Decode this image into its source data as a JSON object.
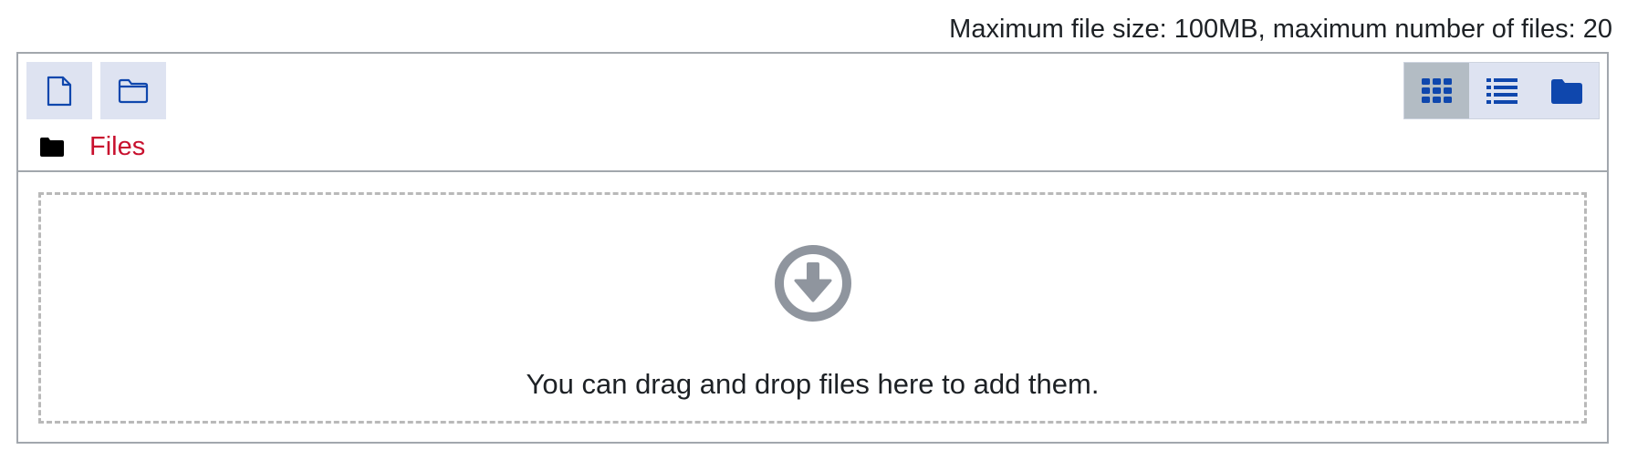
{
  "limits_text": "Maximum file size: 100MB, maximum number of files: 20",
  "toolbar": {
    "add_file_icon": "file-icon",
    "add_folder_icon": "folder-outline-icon",
    "views": [
      {
        "icon": "grid-icon",
        "active": true
      },
      {
        "icon": "list-icon",
        "active": false
      },
      {
        "icon": "folder-tree-icon",
        "active": false
      }
    ]
  },
  "path": {
    "icon": "folder-icon",
    "label": "Files"
  },
  "dropzone": {
    "icon": "download-circle-icon",
    "text": "You can drag and drop files here to add them."
  },
  "colors": {
    "accent_blue": "#0f47ad",
    "link_red": "#c8102e",
    "button_bg": "#dee3f1",
    "active_view_bg": "#b3bcc4",
    "drop_icon_gray": "#8f959e",
    "border_gray": "#a2a7ad"
  }
}
